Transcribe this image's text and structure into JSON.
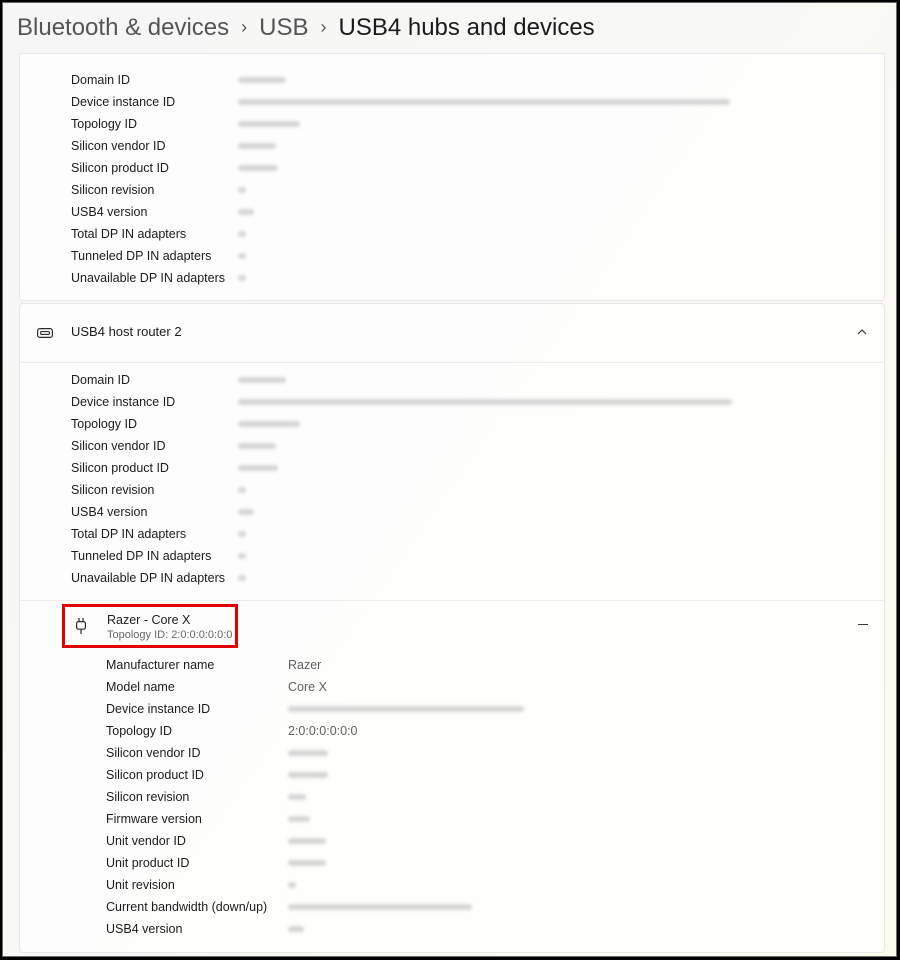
{
  "breadcrumb": {
    "items": [
      "Bluetooth & devices",
      "USB"
    ],
    "current": "USB4 hubs and devices",
    "separator": "›"
  },
  "router1": {
    "labels": [
      "Domain ID",
      "Device instance ID",
      "Topology ID",
      "Silicon vendor ID",
      "Silicon product ID",
      "Silicon revision",
      "USB4 version",
      "Total DP IN adapters",
      "Tunneled DP IN adapters",
      "Unavailable DP IN adapters"
    ]
  },
  "router2": {
    "title": "USB4 host router 2",
    "labels": [
      "Domain ID",
      "Device instance ID",
      "Topology ID",
      "Silicon vendor ID",
      "Silicon product ID",
      "Silicon revision",
      "USB4 version",
      "Total DP IN adapters",
      "Tunneled DP IN adapters",
      "Unavailable DP IN adapters"
    ]
  },
  "device": {
    "title": "Razer - Core X",
    "subtitle": "Topology ID:  2:0:0:0:0:0:0",
    "properties": [
      {
        "label": "Manufacturer name",
        "value": "Razer"
      },
      {
        "label": "Model name",
        "value": "Core X"
      },
      {
        "label": "Device instance ID",
        "value": ""
      },
      {
        "label": "Topology ID",
        "value": "2:0:0:0:0:0:0"
      },
      {
        "label": "Silicon vendor ID",
        "value": ""
      },
      {
        "label": "Silicon product ID",
        "value": ""
      },
      {
        "label": "Silicon revision",
        "value": ""
      },
      {
        "label": "Firmware version",
        "value": ""
      },
      {
        "label": "Unit vendor ID",
        "value": ""
      },
      {
        "label": "Unit product ID",
        "value": ""
      },
      {
        "label": "Unit revision",
        "value": ""
      },
      {
        "label": "Current bandwidth (down/up)",
        "value": ""
      },
      {
        "label": "USB4 version",
        "value": ""
      }
    ]
  },
  "icons": {
    "router": "usb-port-icon",
    "device": "usb-plug-icon",
    "expand": "chevron-up-icon",
    "collapse": "minus-icon"
  },
  "colors": {
    "highlight": "#e30000"
  }
}
